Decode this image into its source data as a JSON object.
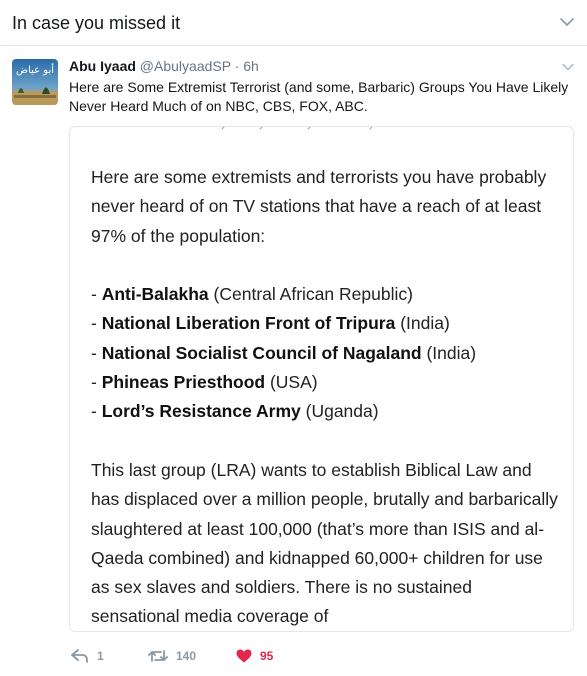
{
  "header": {
    "title": "In case you missed it"
  },
  "tweet": {
    "author_name": "Abu Iyaad",
    "author_handle": "@AbulyaadSP",
    "separator": "·",
    "time": "6h",
    "avatar_text": "أبو عياض",
    "text": "Here are Some Extremist Terrorist (and some, Barbaric) Groups You Have Likely Never Heard Much of on NBC, CBS, FOX,  ABC.",
    "card": {
      "intro": "Here are some extremists and terrorists you have probably never heard of on TV stations that have a reach of at least 97% of the population:",
      "groups": [
        {
          "prefix": "- ",
          "name": "Anti-Balakha",
          "region": " (Central African Republic)"
        },
        {
          "prefix": "- ",
          "name": "National Liberation Front of Tripura",
          "region": " (India)"
        },
        {
          "prefix": "- ",
          "name": "National Socialist Council of Nagaland",
          "region": " (India)"
        },
        {
          "prefix": "- ",
          "name": "Phineas Priesthood",
          "region": " (USA)"
        },
        {
          "prefix": "- ",
          "name": "Lord’s Resistance Army",
          "region": " (Uganda)"
        }
      ],
      "outro": "This last group (LRA) wants to establish Biblical Law and has displaced over a million people, brutally and barbarically slaughtered at least 100,000 (that’s more than ISIS and al-Qaeda combined) and kidnapped 60,000+ children for use as sex slaves and soldiers. There is no sustained sensational media coverage of"
    },
    "actions": {
      "reply_count": "1",
      "retweet_count": "140",
      "like_count": "95"
    }
  },
  "colors": {
    "like": "#e2264d",
    "muted": "#8899a6",
    "border": "#e1e8ed"
  }
}
